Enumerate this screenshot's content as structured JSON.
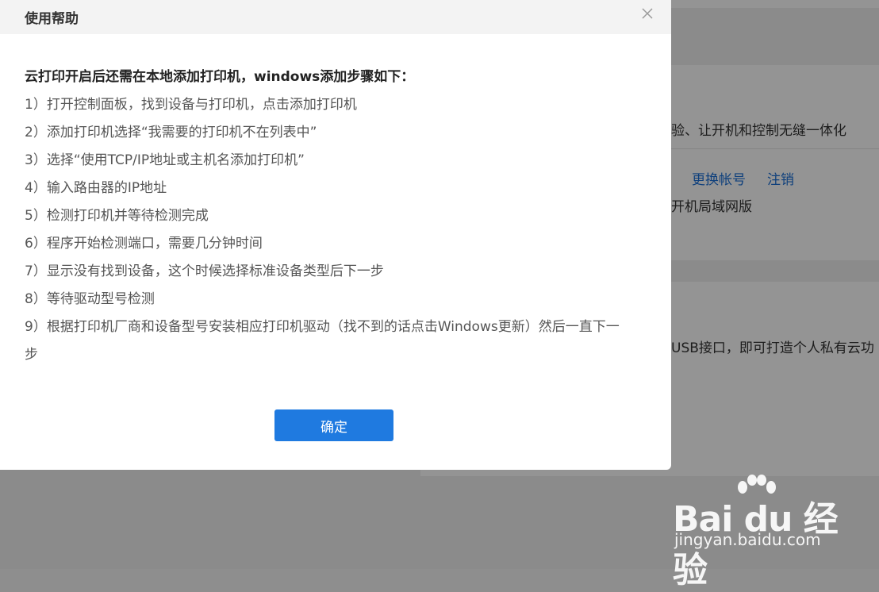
{
  "background": {
    "line1": "验、让开机和控制无缝一体化",
    "link_switch_account": "更换帐号",
    "link_logout": "注销",
    "line2": "开机局域网版",
    "line3": "USB接口，即可打造个人私有云功"
  },
  "dialog": {
    "title": "使用帮助",
    "intro": "云打印开启后还需在本地添加打印机，windows添加步骤如下：",
    "steps": [
      "1）打开控制面板，找到设备与打印机，点击添加打印机",
      "2）添加打印机选择“我需要的打印机不在列表中”",
      "3）选择“使用TCP/IP地址或主机名添加打印机”",
      "4）输入路由器的IP地址",
      "5）检测打印机并等待检测完成",
      "6）程序开始检测端口，需要几分钟时间",
      "7）显示没有找到设备，这个时候选择标准设备类型后下一步",
      "8）等待驱动型号检测",
      "9）根据打印机厂商和设备型号安装相应打印机驱动（找不到的话点击Windows更新）然后一直下一",
      "步"
    ],
    "ok_label": "确定"
  },
  "watermark": {
    "logo": "Bai du 经验",
    "url": "jingyan.baidu.com"
  },
  "colors": {
    "primary_button": "#1f7ae0",
    "link": "#1a6fd6"
  }
}
